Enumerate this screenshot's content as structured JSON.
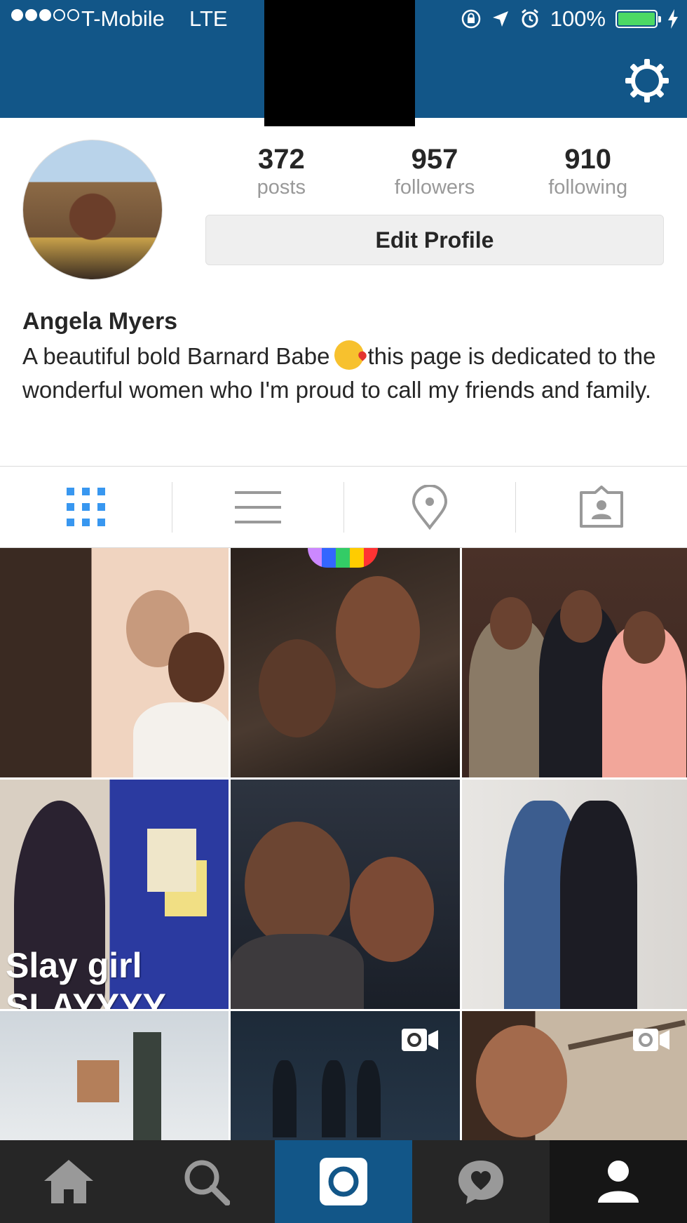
{
  "status_bar": {
    "carrier": "T-Mobile",
    "network": "LTE",
    "battery": "100%",
    "battery_level": 1.0,
    "signal_bars_filled": 3,
    "signal_bars_total": 5
  },
  "header": {
    "bar_color": "#125688",
    "settings_icon": "gear-icon"
  },
  "profile": {
    "stats": [
      {
        "value": "372",
        "label": "posts"
      },
      {
        "value": "957",
        "label": "followers"
      },
      {
        "value": "910",
        "label": "following"
      }
    ],
    "edit_button_label": "Edit Profile",
    "name": "Angela Myers",
    "bio_part1": "A beautiful bold Barnard Babe",
    "bio_part2": "this page is dedicated to the wonderful women who I'm proud to call my friends and family.",
    "bio_emoji": "kissing-face-emoji"
  },
  "tabs": [
    {
      "icon": "grid-icon",
      "active": true
    },
    {
      "icon": "list-icon",
      "active": false
    },
    {
      "icon": "location-pin-icon",
      "active": false
    },
    {
      "icon": "tagged-photos-icon",
      "active": false
    }
  ],
  "posts": {
    "overlay_text_line1": "Slay girl",
    "overlay_text_line2": "SLAYYYY",
    "video_posts": [
      8,
      9
    ]
  },
  "bottom_nav": [
    {
      "icon": "home-icon"
    },
    {
      "icon": "search-icon"
    },
    {
      "icon": "camera-icon"
    },
    {
      "icon": "activity-heart-icon"
    },
    {
      "icon": "profile-icon"
    }
  ],
  "colors": {
    "accent": "#125688",
    "active_tab": "#3897f0",
    "inactive_icon": "#999999",
    "nav_background": "#262626"
  }
}
